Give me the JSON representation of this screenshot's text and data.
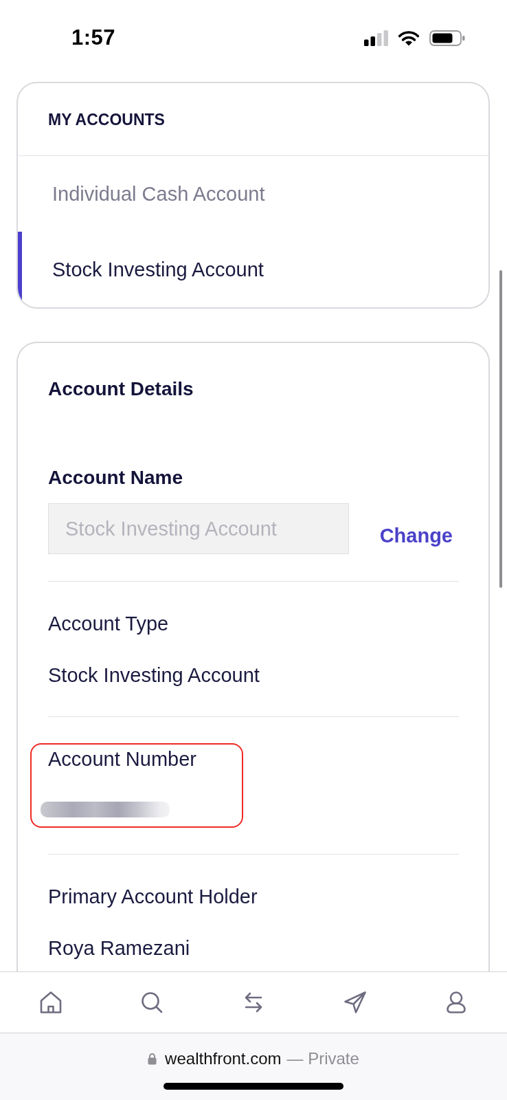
{
  "status_bar": {
    "time": "1:57"
  },
  "accounts_card": {
    "title": "MY ACCOUNTS",
    "items": [
      {
        "label": "Individual Cash Account",
        "selected": false
      },
      {
        "label": "Stock Investing Account",
        "selected": true
      }
    ]
  },
  "details_card": {
    "title": "Account Details",
    "name_field": {
      "label": "Account Name",
      "value": "Stock Investing Account",
      "disabled": true,
      "action": "Change"
    },
    "rows": [
      {
        "kind": "text",
        "label": "Account Type",
        "value": "Stock Investing Account",
        "highlighted": false
      },
      {
        "kind": "redacted",
        "label": "Account Number",
        "highlighted": true
      },
      {
        "kind": "text",
        "label": "Primary Account Holder",
        "value": "Roya Ramezani",
        "highlighted": false
      }
    ]
  },
  "browser_bar": {
    "domain": "wealthfront.com",
    "privacy": "— Private"
  }
}
